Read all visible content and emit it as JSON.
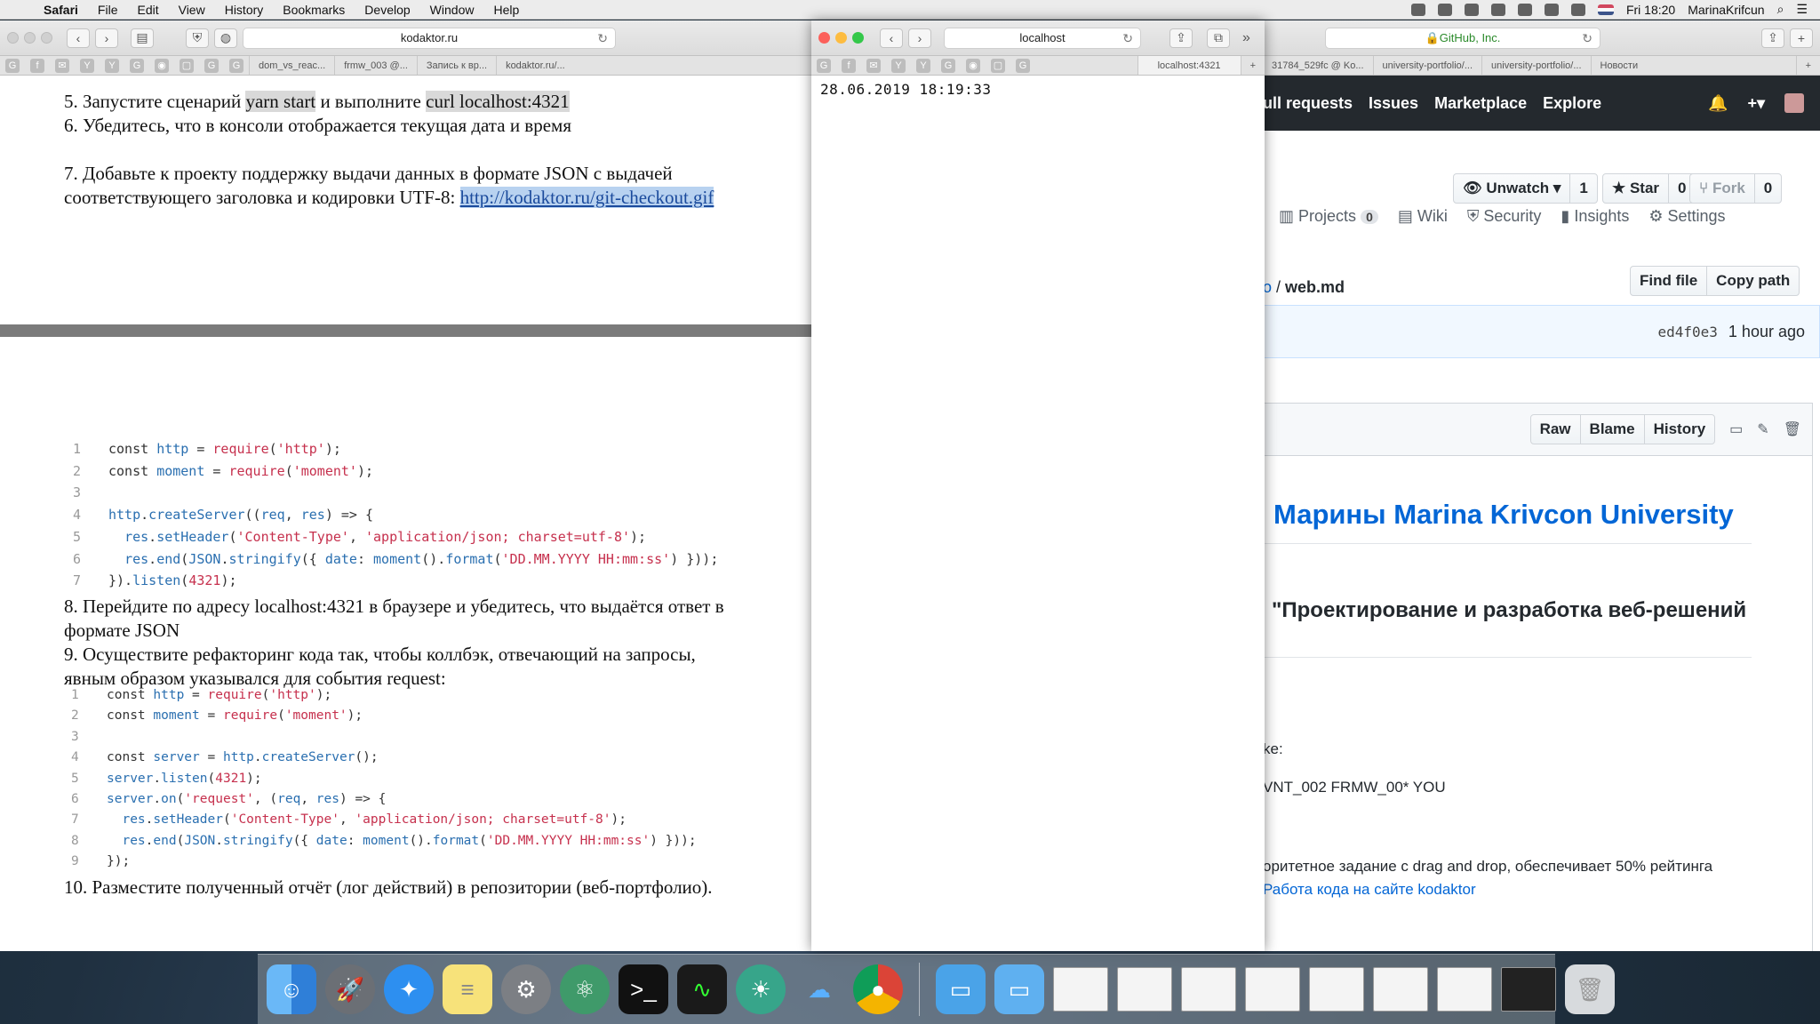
{
  "menubar": {
    "items": [
      "Safari",
      "File",
      "Edit",
      "View",
      "History",
      "Bookmarks",
      "Develop",
      "Window",
      "Help"
    ],
    "clock": "Fri 18:20",
    "user": "MarinaKrifcun"
  },
  "kodaktor_window": {
    "address": "kodaktor.ru",
    "tabs": [
      "dom_vs_reac...",
      "frmw_003 @...",
      "Запись к вр...",
      "kodaktor.ru/..."
    ],
    "step5_prefix": "5. Запустите сценарий ",
    "step5_cmd1": "yarn start",
    "step5_mid": " и выполните ",
    "step5_cmd2": "curl localhost:4321",
    "step6": "6. Убедитесь, что в консоли отображается текущая дата и время",
    "step7_line1": "7. Добавьте к проекту поддержку выдачи данных в формате JSON с выдачей",
    "step7_line2": "соответствующего заголовка и кодировки UTF-8: ",
    "step7_link": "http://kodaktor.ru/git-checkout.gif",
    "step8_line1": "8. Перейдите по адресу localhost:4321 в браузере и убедитесь, что выдаётся ответ в",
    "step8_line2": "формате JSON",
    "step9_line1": "9. Осуществите рефакторинг кода так, чтобы коллбэк, отвечающий на запросы,",
    "step9_line2": "явным образом указывался для события request:",
    "step10": "10. Разместите полученный отчёт (лог действий) в репозитории (веб-портфолио)."
  },
  "code1": {
    "numbers": [
      "1",
      "2",
      "3",
      "4",
      "5",
      "6",
      "7"
    ]
  },
  "code2": {
    "numbers": [
      "1",
      "2",
      "3",
      "4",
      "5",
      "6",
      "7",
      "8",
      "9"
    ]
  },
  "localhost_window": {
    "address": "localhost",
    "tab": "localhost:4321",
    "output": "28.06.2019 18:19:33"
  },
  "github_window": {
    "address": "GitHub, Inc.",
    "tabs": [
      "31784_529fc @ Ko...",
      "university-portfolio/...",
      "university-portfolio/...",
      "Новости"
    ],
    "nav": [
      "ull requests",
      "Issues",
      "Marketplace",
      "Explore"
    ],
    "unwatch_label": "Unwatch",
    "unwatch_count": "1",
    "star_label": "Star",
    "star_count": "0",
    "fork_label": "Fork",
    "fork_count": "0",
    "tab_projects": "Projects",
    "tab_projects_count": "0",
    "tab_wiki": "Wiki",
    "tab_security": "Security",
    "tab_insights": "Insights",
    "tab_settings": "Settings",
    "path_prefix": "o",
    "path_file": "web.md",
    "find_file": "Find file",
    "copy_path": "Copy path",
    "commit_sha": "ed4f0e3",
    "commit_time": "1 hour ago",
    "raw": "Raw",
    "blame": "Blame",
    "history": "History",
    "heading1": "Марины Marina Krivcon University",
    "heading2": "\"Проектирование и разработка веб-решений",
    "text1": "ke:",
    "text2": "VNT_002 FRMW_00* YOU",
    "text3": "оритетное задание с drag and drop, обеспечивает 50% рейтинга",
    "link1": "Работа кода на сайте kodaktor"
  },
  "colors": {
    "github_nav": "#24292e",
    "link_blue": "#0366d6",
    "code_red": "#c6304d",
    "code_blue": "#2a6fb0"
  }
}
